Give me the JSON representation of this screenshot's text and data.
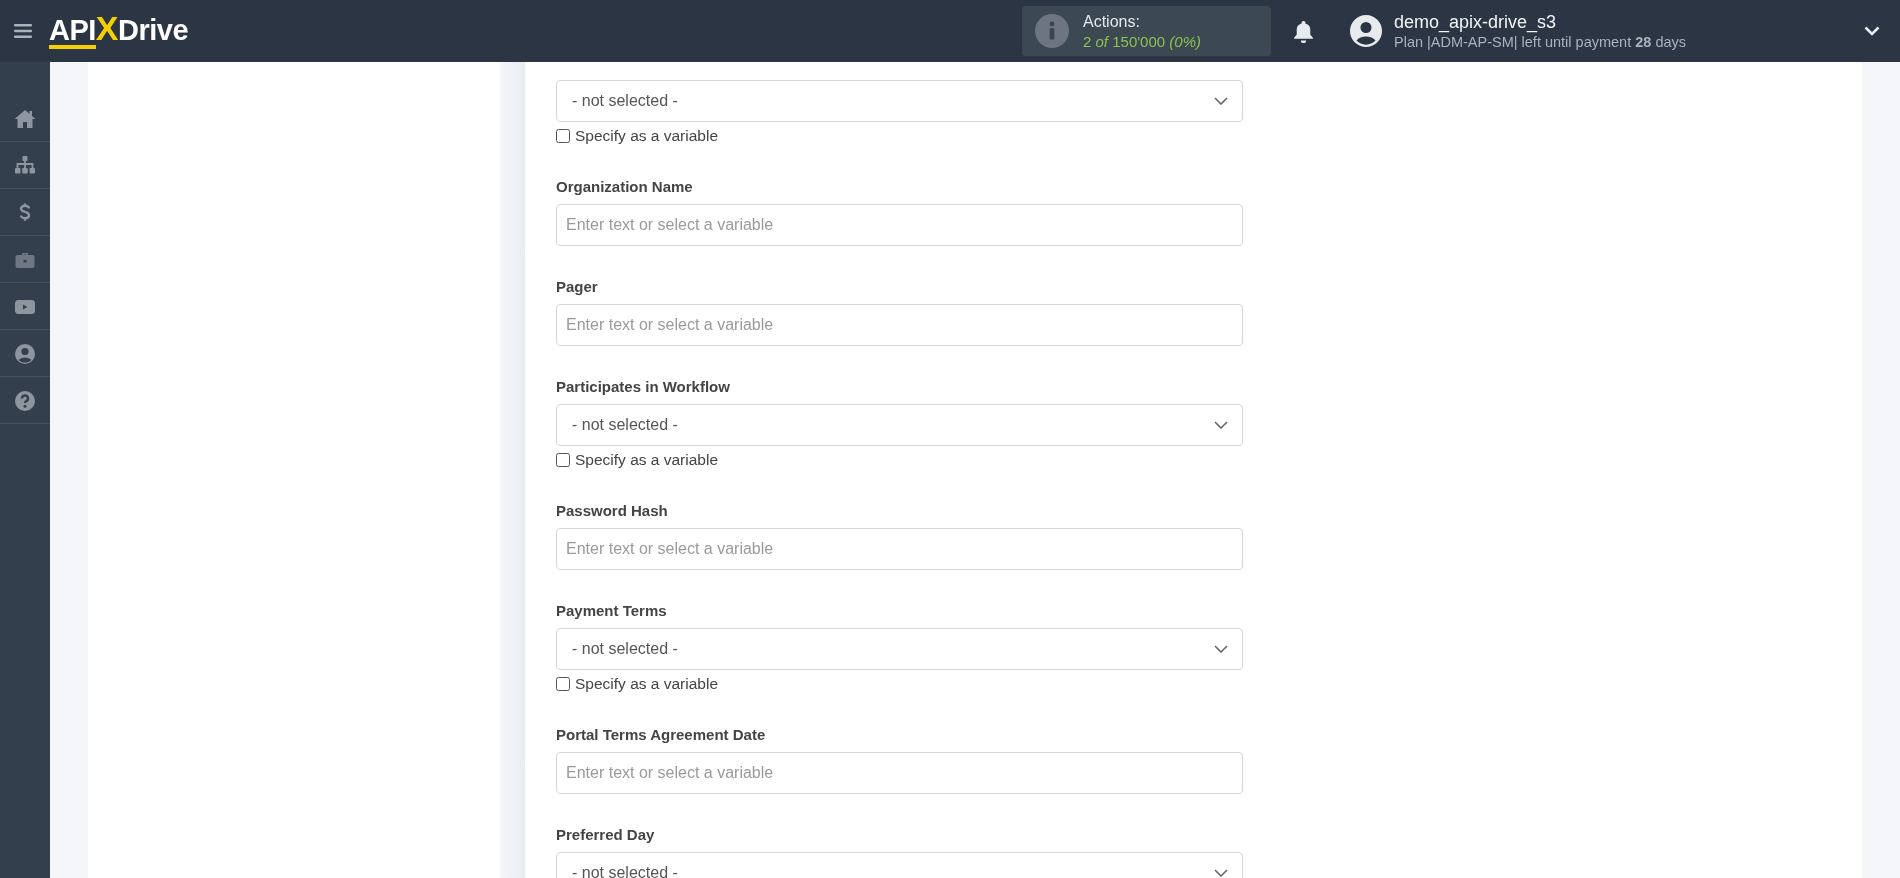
{
  "header": {
    "logo": [
      "API",
      "X",
      "Drive"
    ],
    "actions": {
      "label": "Actions:",
      "value": "2 *of* 150'000 *(0%)*"
    },
    "user": {
      "name": "demo_apix-drive_s3",
      "plan": "Plan |ADM-AP-SM| left until payment **28** days"
    }
  },
  "fields": [
    {
      "kind": "select",
      "value": "- not selected -",
      "variable": {
        "label": "Specify as a variable",
        "checked": false
      }
    },
    {
      "label": "Organization Name",
      "kind": "text",
      "placeholder": "Enter text or select a variable"
    },
    {
      "label": "Pager",
      "kind": "text",
      "placeholder": "Enter text or select a variable"
    },
    {
      "label": "Participates in Workflow",
      "kind": "select",
      "value": "- not selected -",
      "variable": {
        "label": "Specify as a variable",
        "checked": false
      }
    },
    {
      "label": "Password Hash",
      "kind": "text",
      "placeholder": "Enter text or select a variable"
    },
    {
      "label": "Payment Terms",
      "kind": "select",
      "value": "- not selected -",
      "variable": {
        "label": "Specify as a variable",
        "checked": false
      }
    },
    {
      "label": "Portal Terms Agreement Date",
      "kind": "text",
      "placeholder": "Enter text or select a variable"
    },
    {
      "label": "Preferred Day",
      "kind": "select",
      "value": "- not selected -"
    }
  ]
}
